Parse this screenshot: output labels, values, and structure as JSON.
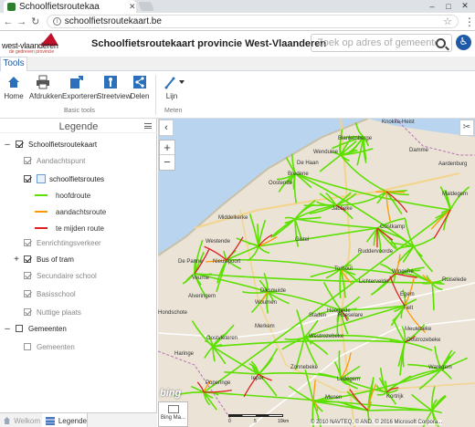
{
  "browser": {
    "tab_title": "Schoolfietsroutekaa",
    "url": "schoolfietsroutekaart.be"
  },
  "header": {
    "logo_name": "west-vlaanderen",
    "logo_sub": "de gedreven provincie",
    "title": "Schoolfietsroutekaart provincie West-Vlaanderen",
    "search_placeholder": "Zoek op adres of gemeente..."
  },
  "ribbon": {
    "tab": "Tools",
    "buttons": {
      "home": "Home",
      "print": "Afdrukken",
      "export": "Exporteren",
      "streetview": "Streetview",
      "share": "Delen",
      "line": "Lijn"
    },
    "groups": {
      "basic": "Basic tools",
      "measure": "Meten"
    }
  },
  "legend": {
    "title": "Legende",
    "items": {
      "schoolfietsroutekaart": "Schoolfietsroutekaart",
      "aandachtspunt": "Aandachtspunt",
      "schoolfietsroutes": "schoolfietsroutes",
      "hoofdroute": "hoofdroute",
      "aandachtsroute": "aandachtsroute",
      "te_mijden_route": "te mijden route",
      "eenrichtingsverkeer": "Eenrichtingsverkeer",
      "bus_of_tram": "Bus of tram",
      "secundaire_school": "Secundaire school",
      "basisschool": "Basisschool",
      "nuttige_plaats": "Nuttige plaats",
      "gemeenten": "Gemeenten",
      "gemeenten_sub": "Gemeenten"
    },
    "colors": {
      "hoofdroute": "#5ce000",
      "aandachtsroute": "#ff9900",
      "te_mijden_route": "#e02020"
    }
  },
  "bottom_tabs": {
    "welkom": "Welkom",
    "legende": "Legende"
  },
  "map": {
    "places": {
      "knokke": "Knokke-Heist",
      "blankenberge": "Blankenberge",
      "wenduine": "Wenduine",
      "de_haan": "De Haan",
      "damme": "Damme",
      "aardenburg": "Aardenburg",
      "maldegem": "Maldegem",
      "bredene": "Bredene",
      "oostende": "Oostende",
      "jabbeke": "Jabbeke",
      "oostkamp": "Oostkamp",
      "middelkerke": "Middelkerke",
      "gistel": "Gistel",
      "westende": "Westende",
      "ruddervoorde": "Ruddervoorde",
      "nieuwpoort": "Nieuwpoort",
      "torhout": "Torhout",
      "lichtervelde": "Lichtervelde",
      "wingene": "Wingene",
      "ruiselede": "Ruiselede",
      "de_panne": "De Panne",
      "veurne": "Veurne",
      "diksmuide": "Diksmuide",
      "roeselare": "Roeselare",
      "tielt": "Tielt",
      "alveringem": "Alveringem",
      "woumen": "Woumen",
      "staden": "Staden",
      "hooglede": "Hooglede",
      "egem": "Egem",
      "hondschote": "Hondschote",
      "merkem": "Merkem",
      "meulebeke": "Meulebeke",
      "oostvleteren": "Oostvleteren",
      "westrozebeke": "Westrozebeke",
      "oostrozebeke": "Oostrozebeke",
      "haringe": "Haringe",
      "zonnebeke": "Zonnebeke",
      "waregem": "Waregem",
      "poperinge": "Poperinge",
      "ieper": "Ieper",
      "ledegem": "Ledegem",
      "kortrijk": "Kortrijk",
      "menen": "Menen"
    },
    "bing": "bing",
    "basemap_label": "Bing Ma...",
    "scale": {
      "s0": "0",
      "s5": "5",
      "s10": "10km"
    },
    "attribution": "© 2010 NAVTEQ, © AND, © 2016 Microsoft Corpora..."
  }
}
